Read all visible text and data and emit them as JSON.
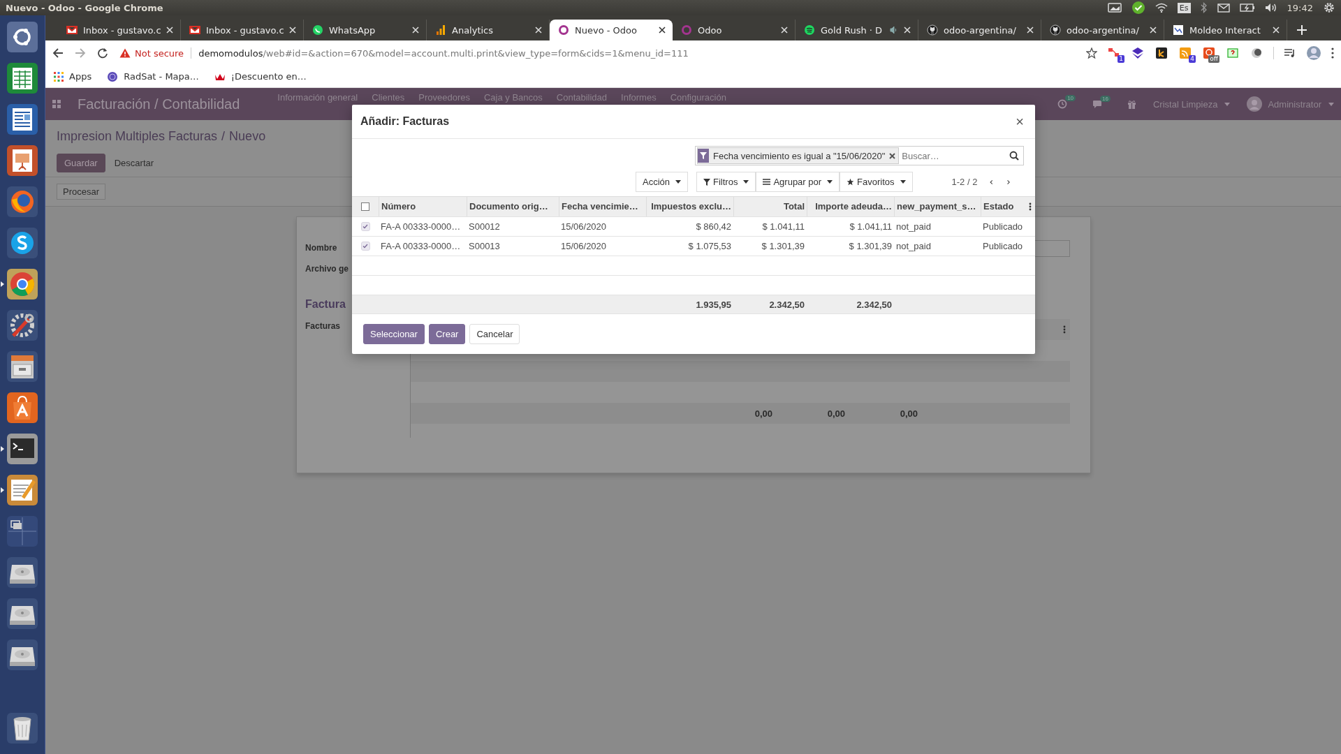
{
  "os_bar": {
    "title": "Nuevo - Odoo - Google Chrome",
    "keyboard": "Es",
    "time": "19:42"
  },
  "launcher": [
    {
      "kind": "dash",
      "running": false
    },
    {
      "kind": "spreadsheet",
      "running": false
    },
    {
      "kind": "writer",
      "running": false
    },
    {
      "kind": "presentation",
      "running": false
    },
    {
      "kind": "firefox",
      "running": false
    },
    {
      "kind": "skype",
      "running": false
    },
    {
      "kind": "chrome",
      "running": true
    },
    {
      "kind": "settings",
      "running": false
    },
    {
      "kind": "cabinet",
      "running": false
    },
    {
      "kind": "store",
      "running": false
    },
    {
      "kind": "terminal",
      "running": true
    },
    {
      "kind": "editor",
      "running": true
    },
    {
      "kind": "workspaces",
      "running": false
    },
    {
      "kind": "drive",
      "running": false
    },
    {
      "kind": "drive",
      "running": false
    },
    {
      "kind": "drive",
      "running": false
    },
    {
      "kind": "trash",
      "running": false
    }
  ],
  "tabs": [
    {
      "kind": "gmail",
      "title": "Inbox - gustavo.c",
      "selected": false,
      "audio": false
    },
    {
      "kind": "gmail",
      "title": "Inbox - gustavo.c",
      "selected": false,
      "audio": false
    },
    {
      "kind": "whatsapp",
      "title": "WhatsApp",
      "selected": false,
      "audio": false
    },
    {
      "kind": "analytics",
      "title": "Analytics",
      "selected": false,
      "audio": false
    },
    {
      "kind": "odoo",
      "title": "Nuevo - Odoo",
      "selected": true,
      "audio": false
    },
    {
      "kind": "odoo",
      "title": "Odoo",
      "selected": false,
      "audio": false
    },
    {
      "kind": "spotify",
      "title": "Gold Rush · D",
      "selected": false,
      "audio": true
    },
    {
      "kind": "github",
      "title": "odoo-argentina/",
      "selected": false,
      "audio": false
    },
    {
      "kind": "github",
      "title": "odoo-argentina/",
      "selected": false,
      "audio": false
    },
    {
      "kind": "moldeo",
      "title": "Moldeo Interact",
      "selected": false,
      "audio": false
    }
  ],
  "address": {
    "security": "Not secure",
    "host": "demomodulos",
    "path": "/web#id=&action=670&model=account.multi.print&view_type=form&cids=1&menu_id=111"
  },
  "extensions": [
    {
      "kind": "arrows",
      "badge": "1"
    },
    {
      "kind": "layers"
    },
    {
      "kind": "k"
    },
    {
      "kind": "feed",
      "badge": "4"
    },
    {
      "kind": "blocker",
      "badge": "off"
    },
    {
      "kind": "help"
    },
    {
      "kind": "moon"
    }
  ],
  "bookmarks": [
    {
      "kind": "apps",
      "label": "Apps"
    },
    {
      "kind": "globe",
      "label": "RadSat - Mapa…"
    },
    {
      "kind": "crown",
      "label": "¡Descuento en…"
    }
  ],
  "odoo_nav": {
    "app": "Facturación / Contabilidad",
    "menu": [
      "Información general",
      "Clientes",
      "Proveedores",
      "Caja y Bancos",
      "Contabilidad",
      "Informes",
      "Configuración"
    ],
    "activity_count": "10",
    "message_count": "16",
    "company": "Cristal Limpieza",
    "user": "Administrator"
  },
  "control_panel": {
    "breadcrumb": [
      "Impresion Multiples Facturas",
      "Nuevo"
    ],
    "breadcrumb_separator": "/",
    "save": "Guardar",
    "discard": "Descartar",
    "action": "Procesar"
  },
  "form": {
    "name_label": "Nombre",
    "file_label": "Archivo ge",
    "section": "Factura",
    "invoices_label": "Facturas",
    "totals": [
      "0,00",
      "0,00",
      "0,00"
    ]
  },
  "dialog": {
    "title": "Añadir: Facturas",
    "close": "×",
    "facet": "Fecha vencimiento es igual a \"15/06/2020\"",
    "search_placeholder": "Buscar…",
    "menus": [
      {
        "kind": "action",
        "label": "Acción"
      },
      {
        "kind": "filter",
        "label": "Filtros"
      },
      {
        "kind": "group",
        "label": "Agrupar por"
      },
      {
        "kind": "favorite",
        "label": "Favoritos"
      }
    ],
    "pager": "1-2 / 2",
    "select_all": false,
    "columns": [
      {
        "label": "Número",
        "kind": "text"
      },
      {
        "label": "Documento orig…",
        "kind": "text"
      },
      {
        "label": "Fecha vencimie…",
        "kind": "text"
      },
      {
        "label": "Impuestos exclu…",
        "kind": "money",
        "total": "1.935,95"
      },
      {
        "label": "Total",
        "kind": "money",
        "total": "2.342,50"
      },
      {
        "label": "Importe adeuda…",
        "kind": "money",
        "total": "2.342,50"
      },
      {
        "label": "new_payment_s…",
        "kind": "text"
      },
      {
        "label": "Estado",
        "kind": "text"
      }
    ],
    "rows": [
      {
        "selected": true,
        "cells": [
          "FA-A 00333-0000…",
          "S00012",
          "15/06/2020",
          "$ 860,42",
          "$ 1.041,11",
          "$ 1.041,11",
          "not_paid",
          "Publicado"
        ]
      },
      {
        "selected": true,
        "cells": [
          "FA-A 00333-0000…",
          "S00013",
          "15/06/2020",
          "$ 1.075,53",
          "$ 1.301,39",
          "$ 1.301,39",
          "not_paid",
          "Publicado"
        ]
      }
    ],
    "buttons": [
      {
        "kind": "primary",
        "label": "Seleccionar"
      },
      {
        "kind": "primary",
        "label": "Crear"
      },
      {
        "kind": "secondary",
        "label": "Cancelar"
      }
    ]
  }
}
